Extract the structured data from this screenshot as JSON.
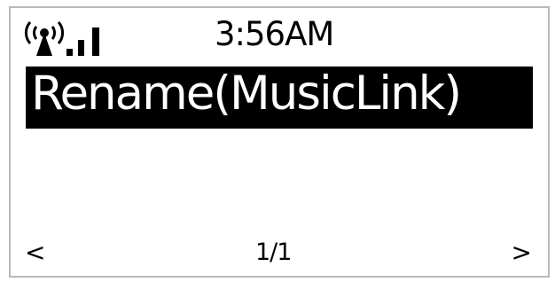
{
  "status_bar": {
    "signal_icon": "wifi-signal-icon",
    "time": "3:56AM"
  },
  "menu": {
    "selected_label": "Rename(MusicLink)"
  },
  "footer": {
    "prev_icon": "<",
    "page_indicator": "1/1",
    "next_icon": ">"
  },
  "colors": {
    "background": "#ffffff",
    "foreground": "#000000",
    "highlight": "#000000",
    "highlight_text": "#ffffff"
  }
}
